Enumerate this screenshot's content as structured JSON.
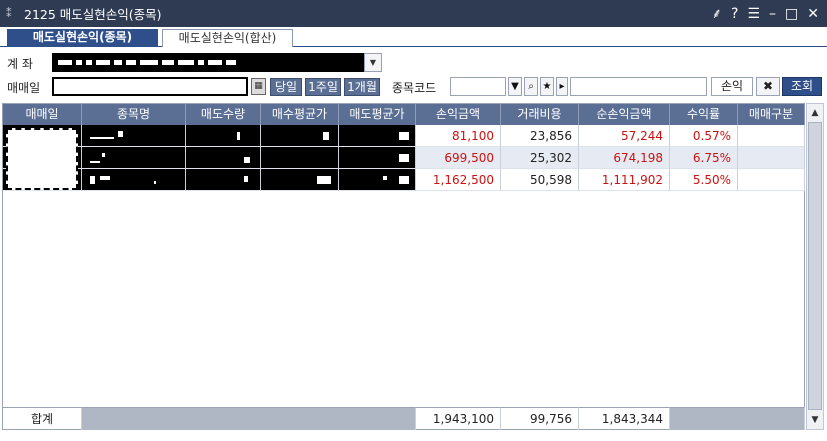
{
  "window": {
    "pin_icon": "pin-icon",
    "title": "2125 매도실현손익(종목)",
    "controls": [
      "pin-edit-icon",
      "help-icon",
      "menu-icon",
      "minimize-icon",
      "maximize-icon",
      "close-icon"
    ]
  },
  "tabs": [
    {
      "label": "매도실현손익(종목)",
      "active": true
    },
    {
      "label": "매도실현손익(합산)",
      "active": false
    }
  ],
  "filters": {
    "account_label": "계  좌",
    "date_label": "매매일",
    "today_label": "당일",
    "week_label": "1주일",
    "month_label": "1개월",
    "code_label": "종목코드",
    "pnl_button": "손익",
    "search_button": "조회"
  },
  "table": {
    "columns": [
      "매매일",
      "종목명",
      "매도수량",
      "매수평균가",
      "매도평균가",
      "손익금액",
      "거래비용",
      "순손익금액",
      "수익률",
      "매매구분"
    ],
    "rows": [
      {
        "pnl": "81,100",
        "cost": "23,856",
        "net": "57,244",
        "rate": "0.57%"
      },
      {
        "pnl": "699,500",
        "cost": "25,302",
        "net": "674,198",
        "rate": "6.75%"
      },
      {
        "pnl": "1,162,500",
        "cost": "50,598",
        "net": "1,111,902",
        "rate": "5.50%"
      }
    ],
    "total_label": "합계",
    "totals": {
      "pnl": "1,943,100",
      "cost": "99,756",
      "net": "1,843,344"
    }
  },
  "colors": {
    "header_bg": "#5b6f95",
    "title_bg": "#2f3b52",
    "accent": "#2f4f8a",
    "loss_red": "#cc1111"
  }
}
